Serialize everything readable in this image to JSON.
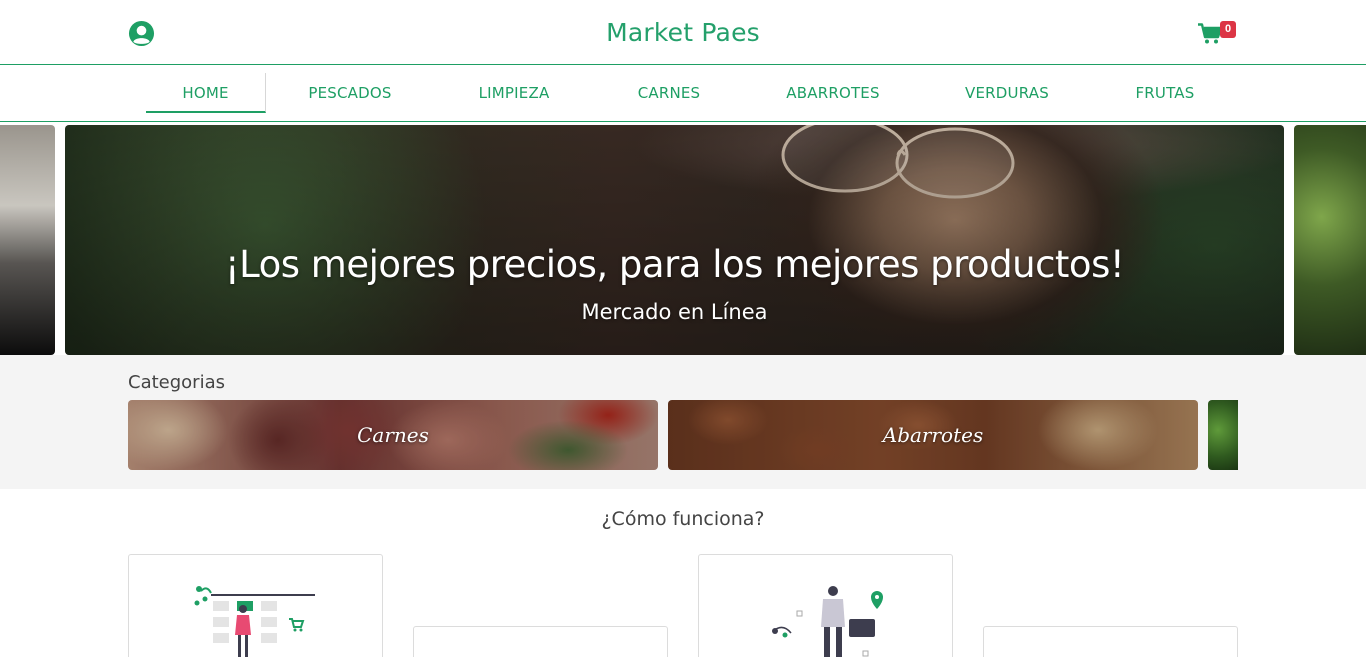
{
  "header": {
    "brand": "Market Paes",
    "cart_count": "0",
    "icons": {
      "user": "user-circle-icon",
      "cart": "shopping-cart-icon"
    }
  },
  "nav": {
    "items": [
      {
        "label": "HOME",
        "active": true
      },
      {
        "label": "PESCADOS",
        "active": false
      },
      {
        "label": "LIMPIEZA",
        "active": false
      },
      {
        "label": "CARNES",
        "active": false
      },
      {
        "label": "ABARROTES",
        "active": false
      },
      {
        "label": "VERDURAS",
        "active": false
      },
      {
        "label": "FRUTAS",
        "active": false
      }
    ]
  },
  "carousel": {
    "title": "¡Los mejores precios, para los mejores productos!",
    "subtitle": "Mercado en Línea"
  },
  "categories": {
    "heading": "Categorias",
    "items": [
      {
        "label": "Carnes"
      },
      {
        "label": "Abarrotes"
      }
    ]
  },
  "how_it_works": {
    "heading": "¿Cómo funciona?"
  },
  "colors": {
    "brand_green": "#1e9f64",
    "badge_red": "#dc3545",
    "section_gray": "#f4f4f4"
  }
}
